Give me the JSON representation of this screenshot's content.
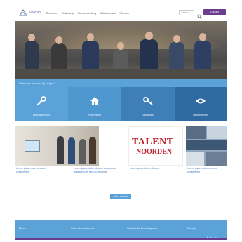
{
  "header": {
    "logo_text": "welkom",
    "nav": [
      "Bedrijven",
      "Onderwijs",
      "Samenwerking",
      "Arbeidsmarkt",
      "Nieuws"
    ],
    "search_placeholder": "Zoeken...",
    "cta_label": "Contact"
  },
  "band": {
    "title": "Waarmee kunnen wij helpen?",
    "tiles": [
      {
        "label": "Bedrijfsservices",
        "icon": "wrench-icon"
      },
      {
        "label": "Huisvesting",
        "icon": "house-icon"
      },
      {
        "label": "Vacatures",
        "icon": "key-icon"
      },
      {
        "label": "Samenwerken",
        "icon": "eye-icon"
      }
    ]
  },
  "news": [
    {
      "title": "Lorem ipsum dolor sit amet, consectetur",
      "date": "",
      "image": "people-and-screen-photo"
    },
    {
      "title": "Lorem ipsum dolor sit amet consectetur adipiscing elit sed do eiusmod",
      "date": "",
      "image": "team-photo"
    },
    {
      "title": "Lorem ipsum dolor sit amet",
      "date": "",
      "image": "talent-logo",
      "logo_line1": "TALENT",
      "logo_line2": "NOORDEN"
    },
    {
      "title": "Lorem ipsum dolor sit amet consectetur",
      "date": "",
      "image": "event-collage-photo"
    }
  ],
  "more_label": "Meer nieuws",
  "footer": {
    "columns": [
      "Menu",
      "Over Noorderpoort",
      "Werken bij Noorderpoort",
      "Privacy"
    ]
  },
  "colors": {
    "accent": "#5aa2d8",
    "brand": "#6b3d8c",
    "logo_red": "#c0202a"
  }
}
